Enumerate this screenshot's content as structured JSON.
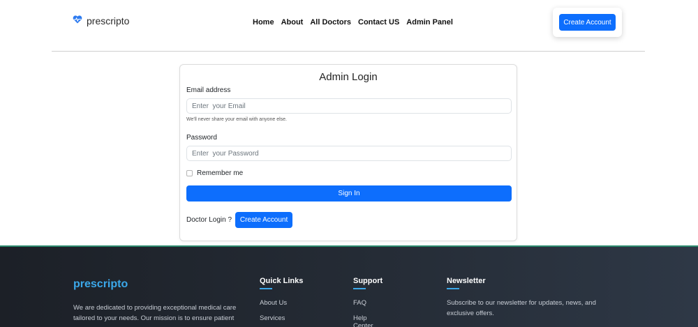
{
  "header": {
    "brand": "prescripto",
    "nav": [
      "Home",
      "About",
      "All Doctors",
      "Contact US",
      "Admin Panel"
    ],
    "create_account": "Create Account"
  },
  "login": {
    "title": "Admin Login",
    "email_label": "Email address",
    "email_placeholder": "Enter  your Email",
    "email_help": "We'll never share your email with anyone else.",
    "password_label": "Password",
    "password_placeholder": "Enter  your Password",
    "remember": "Remember me",
    "signin": "Sign In",
    "doctor_login": "Doctor Login ?",
    "create_account": "Create Account"
  },
  "footer": {
    "brand": "prescripto",
    "about": "We are dedicated to providing exceptional medical care tailored to your needs. Our mission is to ensure patient",
    "quick_links": {
      "title": "Quick Links",
      "items": [
        "About Us",
        "Services"
      ]
    },
    "support": {
      "title": "Support",
      "items": [
        "FAQ",
        "Help Center"
      ]
    },
    "newsletter": {
      "title": "Newsletter",
      "text": "Subscribe to our newsletter for updates, news, and exclusive offers."
    }
  },
  "colors": {
    "primary": "#0d6efd",
    "accent": "#3ba8ea",
    "footer_bg": "#1c2027"
  }
}
